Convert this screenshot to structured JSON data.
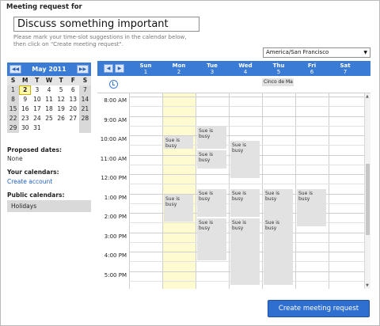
{
  "heading": "Meeting request for",
  "subject": "Discuss something important",
  "hint_line1": "Please mark your time-slot suggestions in the calendar below,",
  "hint_line2": "then click on \"Create meeting request\".",
  "timezone": "America/San Francisco",
  "mini_calendar": {
    "month_label": "May 2011",
    "prev": "◀◀",
    "next": "▶▶",
    "weekday_headers": [
      "S",
      "M",
      "T",
      "W",
      "T",
      "F",
      "S"
    ],
    "weeks": [
      [
        "1",
        "2",
        "3",
        "4",
        "5",
        "6",
        "7"
      ],
      [
        "8",
        "9",
        "10",
        "11",
        "12",
        "13",
        "14"
      ],
      [
        "15",
        "16",
        "17",
        "18",
        "19",
        "20",
        "21"
      ],
      [
        "22",
        "23",
        "24",
        "25",
        "26",
        "27",
        "28"
      ],
      [
        "29",
        "30",
        "31",
        "",
        "",
        "",
        ""
      ]
    ],
    "today": "2"
  },
  "sidebar": {
    "proposed_label": "Proposed dates:",
    "proposed_value": "None",
    "your_label": "Your calendars:",
    "create_account": "Create account",
    "public_label": "Public calendars:",
    "holidays": "Holidays"
  },
  "week": {
    "prev": "◀",
    "next": "▶",
    "days": [
      {
        "name": "Sun",
        "num": "1"
      },
      {
        "name": "Mon",
        "num": "2"
      },
      {
        "name": "Tue",
        "num": "3"
      },
      {
        "name": "Wed",
        "num": "4"
      },
      {
        "name": "Thu",
        "num": "5"
      },
      {
        "name": "Fri",
        "num": "6"
      },
      {
        "name": "Sat",
        "num": "7"
      }
    ],
    "all_day_event": "Cinco de Ma",
    "times": [
      "8:00 AM",
      "9:00 AM",
      "10:00 AM",
      "11:00 AM",
      "12:00 PM",
      "1:00 PM",
      "2:00 PM",
      "3:00 PM",
      "4:00 PM",
      "5:00 PM"
    ],
    "busy_label": "Sue is busy"
  },
  "create_button": "Create meeting request",
  "colors": {
    "accent": "#3a7bd5",
    "today_column": "#fffbd0",
    "busy": "#e2e2e2"
  }
}
